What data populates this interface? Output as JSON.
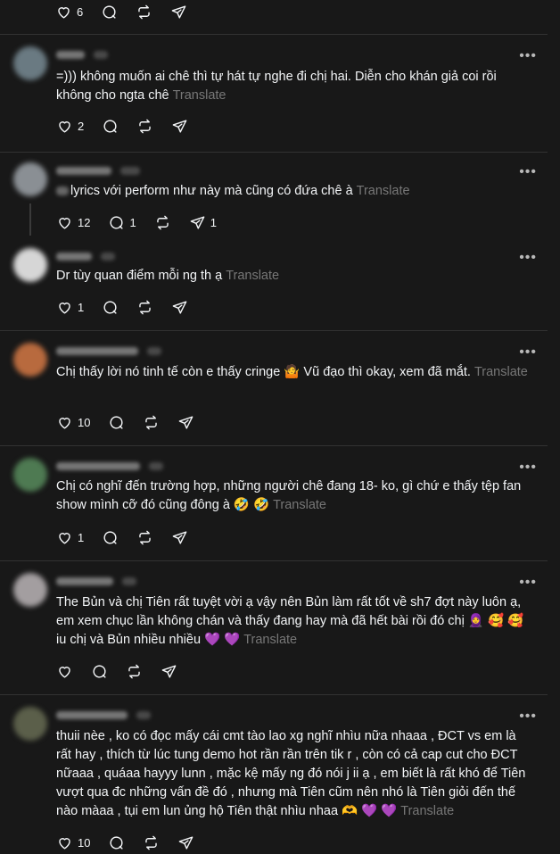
{
  "top": {
    "likes": "6"
  },
  "translate_label": "Translate",
  "posts": [
    {
      "text": "=))) không muốn ai chê thì tự hát tự nghe đi chị hai. Diễn cho khán giả coi rồi không cho ngta chê",
      "likes": "2",
      "replies": "",
      "reposts": ""
    },
    {
      "text": "lyrics với perform như này mà cũng có đứa chê à",
      "likes": "12",
      "replies": "1",
      "reposts": "1"
    },
    {
      "text": "Dr tùy quan điểm mỗi ng th ạ",
      "likes": "1",
      "replies": "",
      "reposts": ""
    },
    {
      "text": "Chị thấy lời nó tinh tế còn e thấy cringe 🤷 Vũ đạo thì okay, xem đã mắt.",
      "likes": "10",
      "replies": "",
      "reposts": ""
    },
    {
      "text": "Chị có nghĩ đến trường hợp, những người chê đang 18- ko, gì chứ e thấy tệp fan show mình cỡ đó cũng đông à 🤣 🤣",
      "likes": "1",
      "replies": "",
      "reposts": ""
    },
    {
      "text": "The Bủn và chị Tiên rất tuyệt vời ạ vậy nên Bủn làm rất tốt về sh7 đợt này luôn ạ, em xem chục lần không chán và thấy đang hay mà đã hết bài rồi đó chị 🧕 🥰 🥰 iu chị và Bủn nhiều nhiều 💜 💜",
      "likes": "",
      "replies": "",
      "reposts": ""
    },
    {
      "text": "thuii nèe , ko có đọc mấy cái cmt tào lao xg nghĩ nhìu nữa nhaaa , ĐCT vs em là rất hay , thích từ lúc tung demo hot rần rần trên tik r , còn có cả cap cut cho ĐCT nữaaa , quáaa hayyy lunn , mặc kệ mấy ng đó nói j ii ạ , em biết là rất khó để Tiên vượt qua đc những vấn đề đó , nhưng mà Tiên cũm nên nhó là Tiên giỏi đến thế nào màaa , tụi em lun ủng hộ Tiên thật nhìu nhaa 🫶 💜 💜",
      "likes": "10",
      "replies": "",
      "reposts": ""
    }
  ],
  "colors": {
    "background": "#181818",
    "text": "#f3f5f7",
    "muted": "#777777",
    "divider": "#323232"
  }
}
